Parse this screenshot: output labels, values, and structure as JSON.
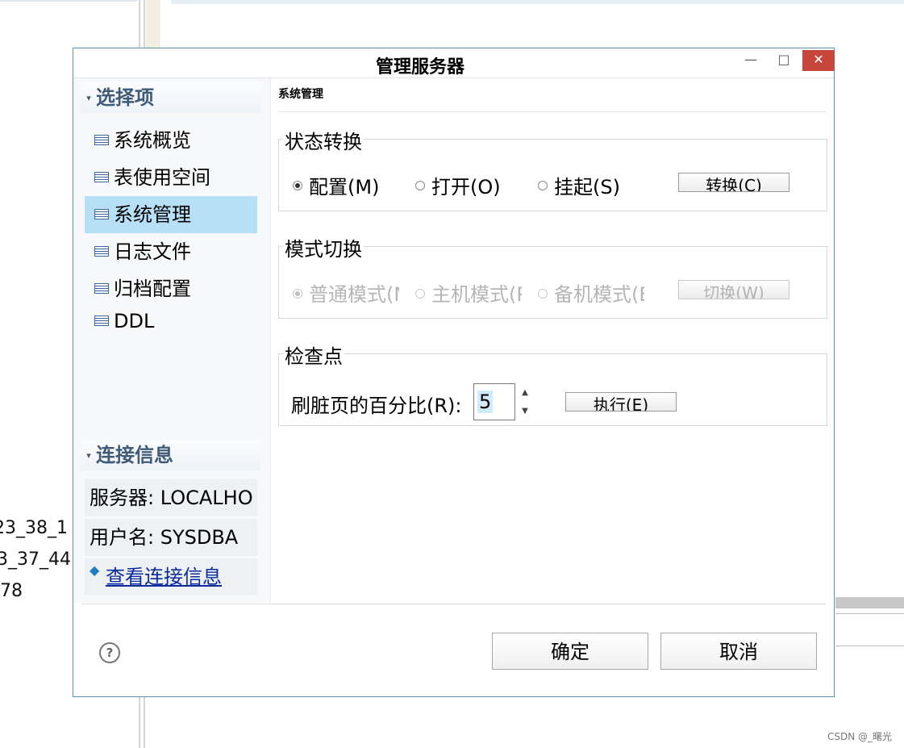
{
  "background": {
    "text_lines": [
      "23_38_1",
      "3_37_44",
      "78"
    ]
  },
  "watermark": "CSDN @_曙光",
  "dialog": {
    "title": "管理服务器",
    "window_controls": {
      "minimize": "—",
      "maximize": "□",
      "close": "✕"
    },
    "nav": {
      "header": "选择项",
      "items": [
        {
          "label": "系统概览",
          "selected": false
        },
        {
          "label": "表使用空间",
          "selected": false
        },
        {
          "label": "系统管理",
          "selected": true
        },
        {
          "label": "日志文件",
          "selected": false
        },
        {
          "label": "归档配置",
          "selected": false
        },
        {
          "label": "DDL",
          "selected": false
        }
      ]
    },
    "connection": {
      "header": "连接信息",
      "server": "服务器: LOCALHO",
      "user": "用户名: SYSDBA",
      "link": "查看连接信息"
    },
    "content": {
      "title": "系统管理",
      "state_group": {
        "label": "状态转换",
        "options": [
          "配置(M)",
          "打开(O)",
          "挂起(S)"
        ],
        "selected_index": 0,
        "button": "转换(C)"
      },
      "mode_group": {
        "label": "模式切换",
        "options": [
          "普通模式(N",
          "主机模式(P",
          "备机模式(B"
        ],
        "selected_index": 0,
        "button": "切换(W)",
        "enabled": false
      },
      "checkpoint_group": {
        "label": "检查点",
        "field_label": "刷脏页的百分比(R):",
        "value": "5",
        "button": "执行(E)"
      }
    },
    "footer": {
      "help": "?",
      "ok": "确定",
      "cancel": "取消"
    }
  }
}
